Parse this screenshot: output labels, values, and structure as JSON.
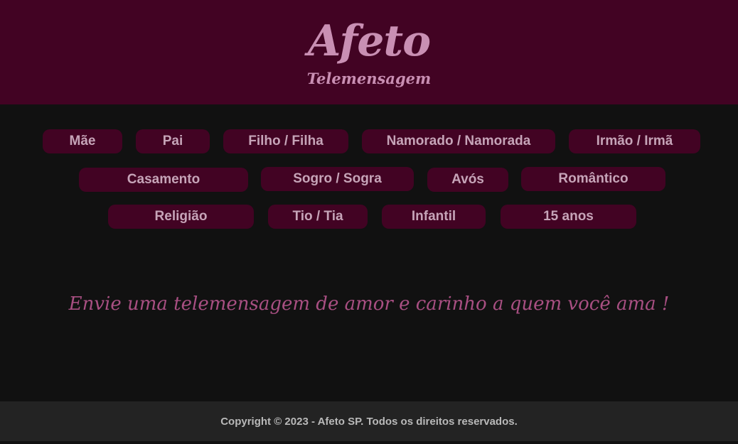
{
  "header": {
    "logo": "Afeto",
    "tagline": "Telemensagem",
    "bg_color": "#420323",
    "text_color": "#c98fb3"
  },
  "categories": [
    {
      "label": "Mãe"
    },
    {
      "label": "Pai"
    },
    {
      "label": "Filho / Filha"
    },
    {
      "label": "Namorado / Namorada"
    },
    {
      "label": "Irmão / Irmã"
    },
    {
      "label": "Casamento"
    },
    {
      "label": "Sogro / Sogra"
    },
    {
      "label": "Avós"
    },
    {
      "label": "Romântico"
    },
    {
      "label": "Religião"
    },
    {
      "label": "Tio / Tia"
    },
    {
      "label": "Infantil"
    },
    {
      "label": "15 anos"
    }
  ],
  "main": {
    "cta": "Envie uma telemensagem de amor e carinho  a quem você ama !"
  },
  "footer": {
    "copyright": "Copyright © 2023 - Afeto  SP. Todos os direitos reservados."
  },
  "colors": {
    "page_bg": "#111111",
    "button_bg": "#420323",
    "button_text": "#c6a4b8",
    "cta_text": "#a84f82",
    "footer_bg": "#232323"
  }
}
